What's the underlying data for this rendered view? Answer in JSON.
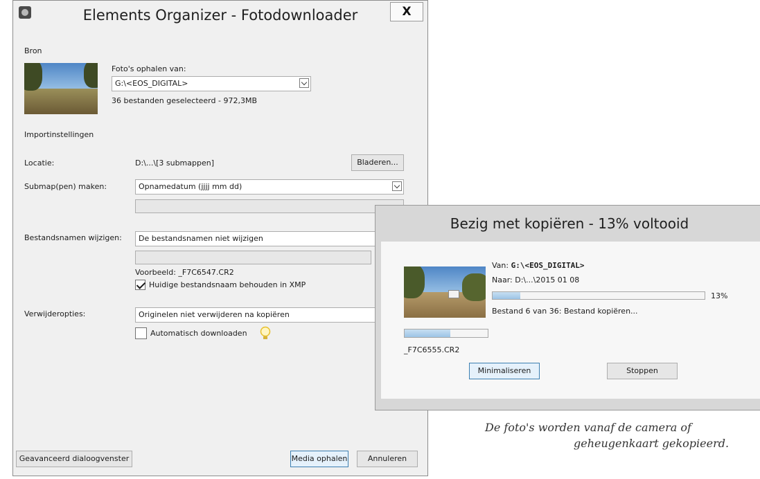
{
  "main_dialog": {
    "title": "Elements Organizer - Fotodownloader",
    "close": "X",
    "source_section": "Bron",
    "fetch_from_label": "Foto's ophalen van:",
    "source_value": "G:\\<EOS_DIGITAL>",
    "selected_summary": "36 bestanden geselecteerd - 972,3MB",
    "import_section": "Importinstellingen",
    "location_label": "Locatie:",
    "location_value": "D:\\...\\[3 submappen]",
    "browse_button": "Bladeren...",
    "subfolder_label": "Submap(pen) maken:",
    "subfolder_value": "Opnamedatum (jjjj mm dd)",
    "rename_label": "Bestandsnamen wijzigen:",
    "rename_value": "De bestandsnamen niet wijzigen",
    "plus_symbol": "+",
    "example_text": "Voorbeeld: _F7C6547.CR2",
    "keep_name_checkbox": "Huidige bestandsnaam behouden in XMP",
    "keep_name_checked": true,
    "delete_label": "Verwijderopties:",
    "delete_value": "Originelen niet verwijderen na kopiëren",
    "auto_download_checkbox": "Automatisch downloaden",
    "auto_download_checked": false,
    "advanced_button": "Geavanceerd dialoogvenster",
    "get_media_button": "Media ophalen",
    "cancel_button": "Annuleren"
  },
  "copy_dialog": {
    "title": "Bezig met kopiëren - 13% voltooid",
    "from_label": "Van:",
    "from_value": "G:\\<EOS_DIGITAL>",
    "to_text": "Naar: D:\\...\\2015 01 08",
    "overall_percent_text": "13%",
    "overall_progress": 0.13,
    "status": "Bestand 6 van 36: Bestand kopiëren...",
    "file_progress": 0.55,
    "filename": "_F7C6555.CR2",
    "minimize_button": "Minimaliseren",
    "stop_button": "Stoppen"
  },
  "caption": {
    "line1": "De foto's worden vanaf de camera of",
    "line2": "geheugenkaart gekopieerd."
  },
  "colors": {
    "dialog_bg": "#f0f0f0",
    "progress_fill": "#9dc4e6",
    "primary_border": "#3c7fb1",
    "bulb": "#f3d24a"
  }
}
